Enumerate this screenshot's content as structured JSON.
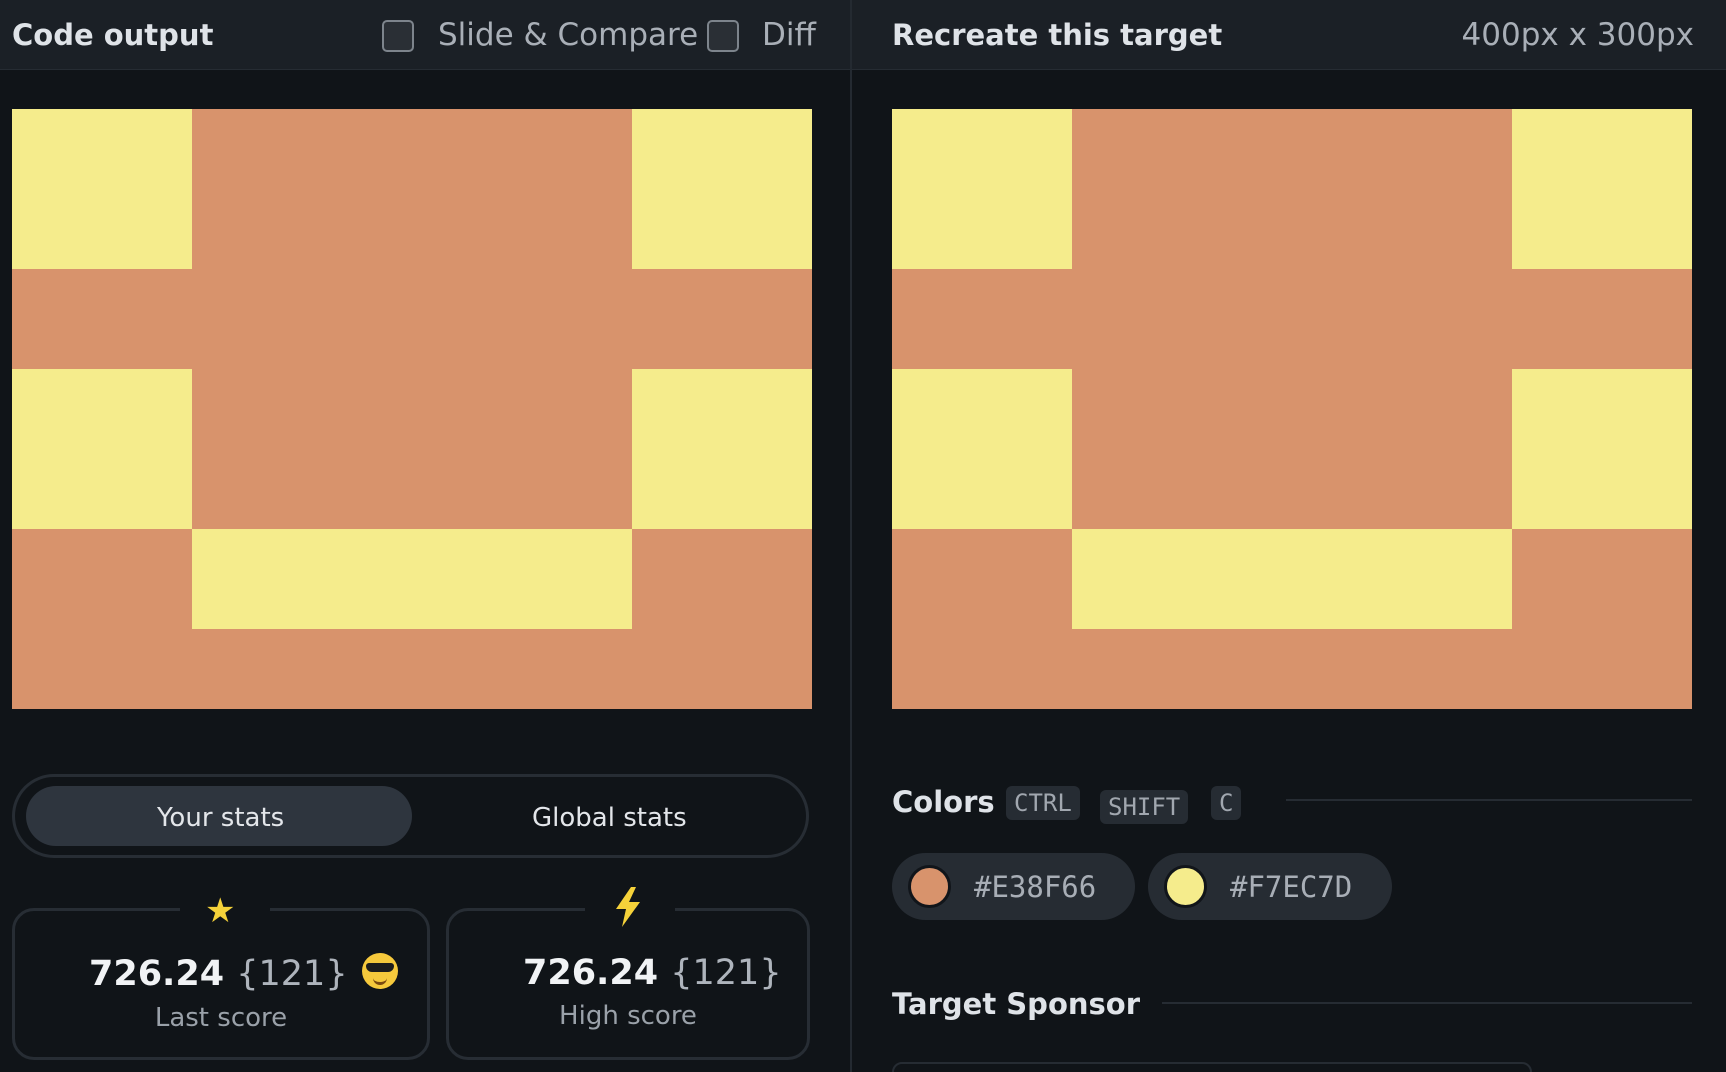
{
  "left_header": {
    "title": "Code output",
    "slide_compare_label": "Slide & Compare",
    "diff_label": "Diff"
  },
  "right_header": {
    "title": "Recreate this target",
    "dimensions": "400px x 300px"
  },
  "stats_toggle": {
    "your_stats": "Your stats",
    "global_stats": "Global stats",
    "active": "Your stats"
  },
  "last_score": {
    "icon": "star-icon",
    "value": "726.24",
    "count": "{121}",
    "emoji": "sunglasses-face-emoji",
    "label": "Last score"
  },
  "high_score": {
    "icon": "lightning-icon",
    "value": "726.24",
    "count": "{121}",
    "label": "High score"
  },
  "colors_section": {
    "title": "Colors",
    "shortcut": [
      "CTRL",
      "SHIFT",
      "C"
    ],
    "swatches": [
      {
        "hex": "#E38F66",
        "label": "#E38F66"
      },
      {
        "hex": "#F7EC7D",
        "label": "#F7EC7D"
      }
    ]
  },
  "sponsor_section": {
    "title": "Target Sponsor"
  },
  "canvas_colors": {
    "background": "#d8936c",
    "blocks": "#f5ec8c"
  }
}
